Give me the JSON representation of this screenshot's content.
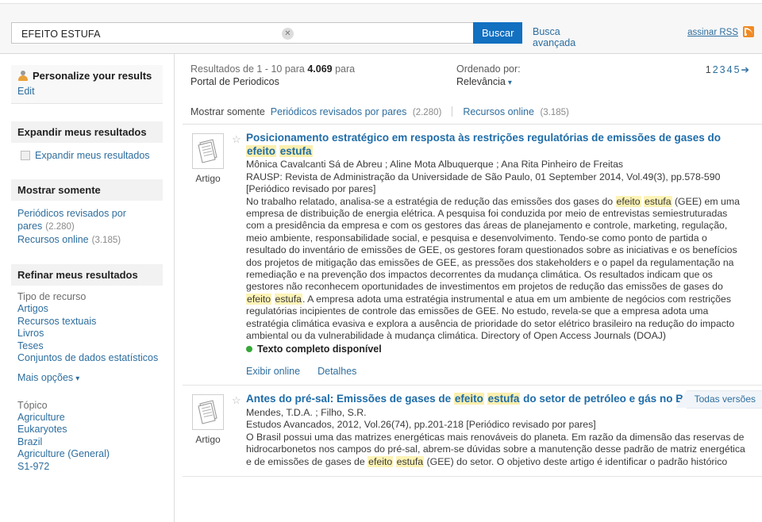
{
  "search": {
    "query_value": "EFEITO ESTUFA",
    "placeholder": "",
    "clear_icon": "✕",
    "submit_label": "Buscar",
    "advanced_label": "Busca avançada",
    "rss_label": "assinar RSS"
  },
  "sidebar": {
    "personalize": {
      "title": "Personalize your results",
      "edit_label": "Edit"
    },
    "expand": {
      "header": "Expandir meus resultados",
      "checkbox_label": "Expandir meus resultados"
    },
    "show_only": {
      "header": "Mostrar somente",
      "items": [
        {
          "label": "Periódicos revisados por pares",
          "count": "(2.280)"
        },
        {
          "label": "Recursos online",
          "count": "(3.185)"
        }
      ]
    },
    "refine": {
      "header": "Refinar meus resultados",
      "groups": [
        {
          "title": "Tipo de recurso",
          "items": [
            "Artigos",
            "Recursos textuais",
            "Livros",
            "Teses",
            "Conjuntos de dados estatísticos"
          ],
          "more_label": "Mais opções"
        },
        {
          "title": "Tópico",
          "items": [
            "Agriculture",
            "Eukaryotes",
            "Brazil",
            "Agriculture (General)",
            "S1-972"
          ]
        }
      ]
    }
  },
  "results_header": {
    "count_prefix": "Resultados de 1 - 10 para ",
    "count_value": "4.069",
    "count_suffix": " para",
    "portal": "Portal de Periodicos",
    "sort_label": "Ordenado por:",
    "sort_value": "Relevância",
    "pages": [
      "1",
      "2",
      "3",
      "4",
      "5"
    ],
    "next_arrow": "➔",
    "show_only_label": "Mostrar somente",
    "show_only_items": [
      {
        "label": "Periódicos revisados por pares",
        "count": "(2.280)"
      },
      {
        "label": "Recursos online",
        "count": "(3.185)"
      }
    ]
  },
  "results": [
    {
      "type_label": "Artigo",
      "title_pre": "Posicionamento estratégico em resposta às restrições regulatórias de emissões de gases do ",
      "title_mark1": "efeito",
      "title_mid": " ",
      "title_mark2": "estufa",
      "title_post": "",
      "authors": "Mônica Cavalcanti Sá de Abreu ; Aline Mota Albuquerque ; Ana Rita Pinheiro de Freitas",
      "source": "RAUSP: Revista de Administração da Universidade de São Paulo, 01 September 2014, Vol.49(3), pp.578-590 [Periódico revisado por pares]",
      "abstract_1": "No trabalho relatado, analisa-se a estratégia de redução das emissões dos gases do ",
      "abstract_mark_a1": "efeito",
      "abstract_mark_a2": "estufa",
      "abstract_2": " (GEE) em uma empresa de distribuição de energia elétrica. A pesquisa foi conduzida por meio de entrevistas semiestruturadas com a presidência da empresa e com os gestores das áreas de planejamento e controle, marketing, regulação, meio ambiente, responsabilidade social, e pesquisa e desenvolvimento. Tendo-se como ponto de partida o resultado do inventário de emissões de GEE, os gestores foram questionados sobre as iniciativas e os benefícios dos projetos de mitigação das emissões de GEE, as pressões dos stakeholders e o papel da regulamentação na remediação e na prevenção dos impactos decorrentes da mudança climática. Os resultados indicam que os gestores não reconhecem oportunidades de investimentos em projetos de redução das emissões de gases do ",
      "abstract_mark_b1": "efeito",
      "abstract_mark_b2": "estufa",
      "abstract_3": ". A empresa adota uma estratégia instrumental e atua em um ambiente de negócios com restrições regulatórias incipientes de controle das emissões de GEE. No estudo, revela-se que a empresa adota uma estratégia climática evasiva e explora a ausência de prioridade do setor elétrico brasileiro na redução do impacto ambiental ou da vulnerabilidade à mudança climática. Directory of Open Access Journals (DOAJ)",
      "fulltext_label": "Texto completo disponível",
      "action_view": "Exibir online",
      "action_details": "Detalhes",
      "versions_label": null
    },
    {
      "type_label": "Artigo",
      "title_pre": "Antes do pré-sal: Emissões de gases de ",
      "title_mark1": "efeito",
      "title_mid": " ",
      "title_mark2": "estufa",
      "title_post": " do setor de petróleo e gás no Brasil",
      "authors": "Mendes, T.D.A. ; Filho, S.R.",
      "source": "Estudos Avancados, 2012, Vol.26(74), pp.201-218 [Periódico revisado por pares]",
      "abstract_1": "O Brasil possui uma das matrizes energéticas mais renováveis do planeta. Em razão da dimensão das reservas de hidrocarbonetos nos campos do pré-sal, abrem-se dúvidas sobre a manutenção desse padrão de matriz energética e de emissões de gases de ",
      "abstract_mark_a1": "efeito",
      "abstract_mark_a2": "estufa",
      "abstract_2": " (GEE) do setor. O objetivo deste artigo é identificar o padrão histórico",
      "abstract_mark_b1": "",
      "abstract_mark_b2": "",
      "abstract_3": "",
      "fulltext_label": "",
      "action_view": "",
      "action_details": "",
      "versions_label": "Todas versões"
    }
  ],
  "colors": {
    "accent_blue": "#1270c0",
    "link_blue": "#2e6e9e",
    "highlight_yellow": "#fdf3b6",
    "rss_orange": "#f08a24",
    "available_green": "#36a836"
  }
}
